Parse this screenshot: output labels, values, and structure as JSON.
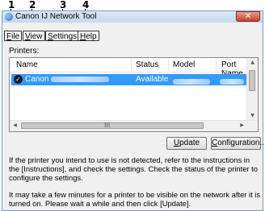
{
  "callouts": [
    "1",
    "2",
    "3",
    "4"
  ],
  "window": {
    "title": "Canon IJ Network Tool",
    "close_glyph": "✕"
  },
  "menu": {
    "file": {
      "underlined": "F",
      "rest": "ile"
    },
    "view": {
      "underlined": "V",
      "rest": "iew"
    },
    "settings": {
      "underlined": "S",
      "rest": "ettings"
    },
    "help": {
      "underlined": "H",
      "rest": "elp"
    }
  },
  "printers_label": "Printers:",
  "columns": {
    "name": "Name",
    "status": "Status",
    "model": "Model",
    "port": "Port Name"
  },
  "printer_row": {
    "name_prefix": "Canon",
    "status": "Available",
    "check_glyph": "✓"
  },
  "scrollbar": {
    "up": "▲",
    "down": "▼",
    "left": "◀",
    "right": "▶",
    "grip": "III"
  },
  "buttons": {
    "update": {
      "underlined": "U",
      "rest": "pdate"
    },
    "configuration": {
      "underlined": "C",
      "rest": "onfiguration..."
    }
  },
  "messages": {
    "instructions": "If the printer you intend to use is not detected, refer to the instructions in the [Instructions], and check the settings. Check the status of the printer to configure the settings.",
    "wait": "It may take a few minutes for a printer to be visible on the network after it is turned on. Please wait a while and then click [Update]."
  },
  "colors": {
    "selection": "#3399ff",
    "window_border": "#7a9cc4",
    "close_button": "#c9422b"
  }
}
